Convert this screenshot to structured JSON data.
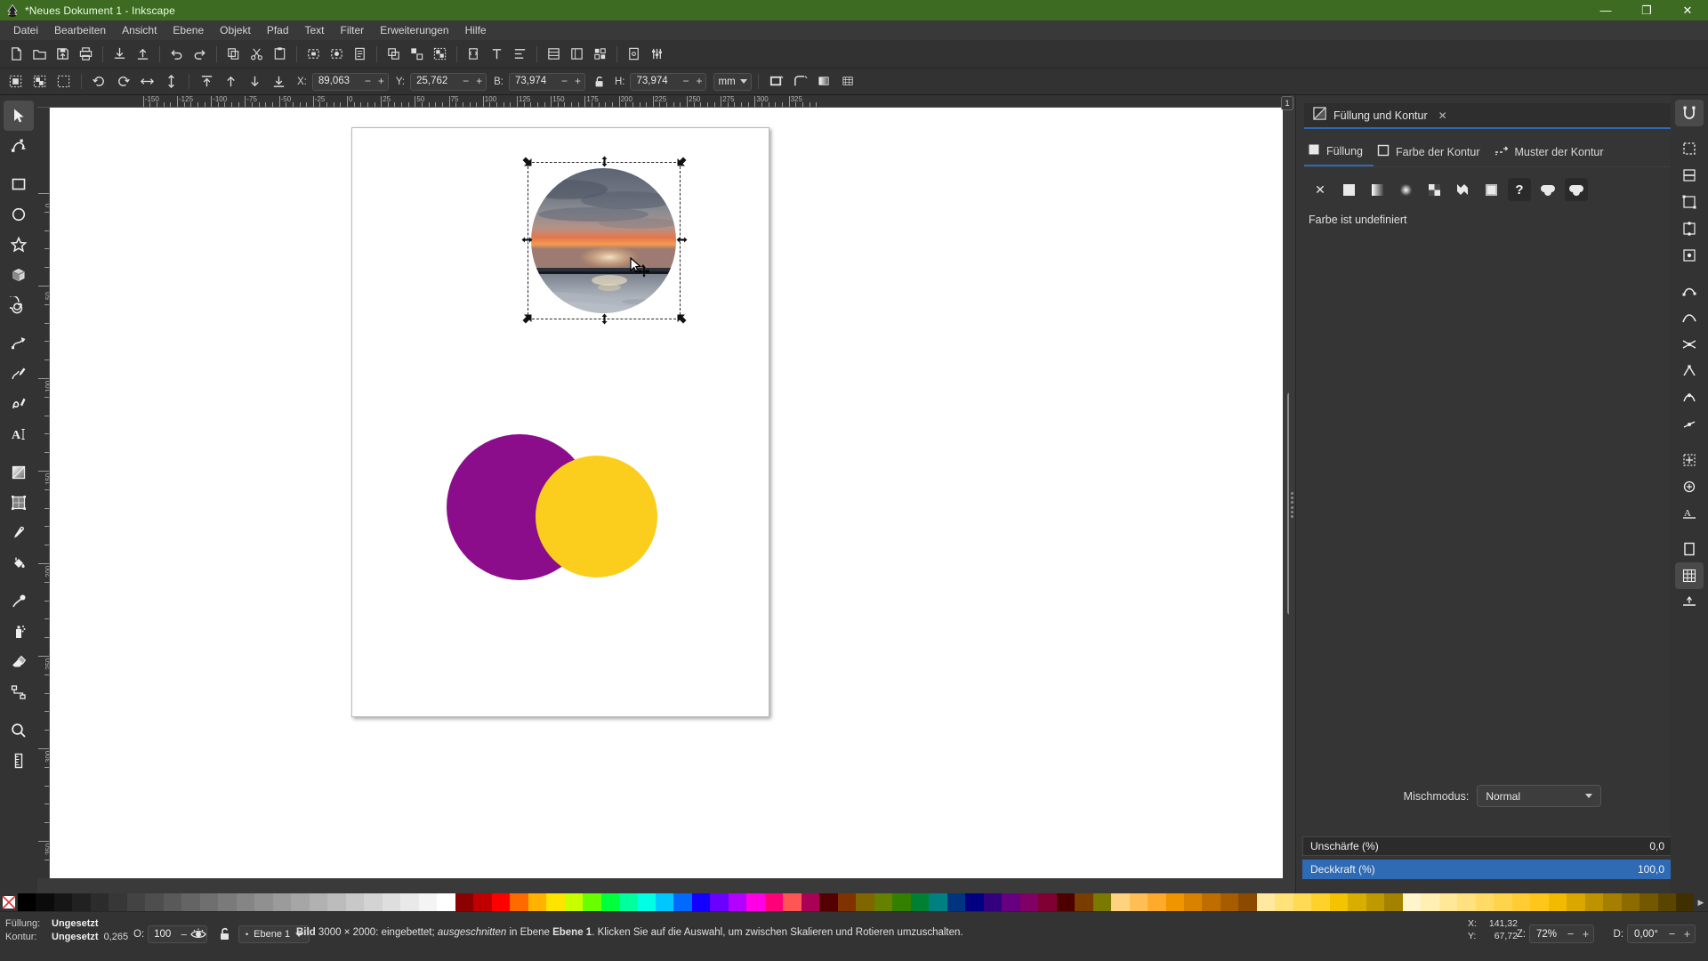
{
  "window": {
    "title": "*Neues Dokument 1 - Inkscape",
    "minimize": "—",
    "maximize": "❐",
    "close": "✕"
  },
  "menubar": {
    "items": [
      "Datei",
      "Bearbeiten",
      "Ansicht",
      "Ebene",
      "Objekt",
      "Pfad",
      "Text",
      "Filter",
      "Erweiterungen",
      "Hilfe"
    ]
  },
  "command_bar": {
    "buttons": [
      "new-document-icon",
      "open-document-icon",
      "save-document-icon",
      "print-icon",
      "import-icon",
      "export-icon",
      "undo-icon",
      "redo-icon",
      "copy-icon",
      "cut-icon",
      "paste-icon",
      "zoom-selection-icon",
      "zoom-drawing-icon",
      "zoom-page-icon",
      "duplicate-icon",
      "clone-icon",
      "group-icon",
      "ungroup-icon",
      "xml-editor-icon",
      "text-tool-icon",
      "align-icon",
      "objects-icon",
      "layers-icon",
      "tiled-clones-icon",
      "document-properties-icon",
      "preferences-icon"
    ]
  },
  "tool_options": {
    "select_all_icon": "select-all-icon",
    "select_all_layers_icon": "select-all-layers-icon",
    "deselect_icon": "deselect-icon",
    "rotate_ccw_icon": "rotate-ccw-icon",
    "rotate_cw_icon": "rotate-cw-icon",
    "flip_h_icon": "flip-horizontal-icon",
    "flip_v_icon": "flip-vertical-icon",
    "raise_to_top_icon": "raise-to-top-icon",
    "raise_icon": "raise-icon",
    "lower_icon": "lower-icon",
    "lower_to_bottom_icon": "lower-to-bottom-icon",
    "x_label": "X:",
    "x_value": "89,063",
    "y_label": "Y:",
    "y_value": "25,762",
    "w_label": "B:",
    "w_value": "73,974",
    "h_label": "H:",
    "h_value": "73,974",
    "lock_icon": "unlocked-ratio-icon",
    "unit": "mm",
    "minus": "−",
    "plus": "+",
    "affect_stroke_icon": "affect-stroke-width-icon",
    "affect_corners_icon": "affect-rounded-corners-icon",
    "affect_gradients_icon": "affect-gradients-icon",
    "affect_patterns_icon": "affect-patterns-icon"
  },
  "toolbox": {
    "tools": [
      {
        "name": "selector-tool",
        "icon": "arrow-cursor-icon",
        "active": true
      },
      {
        "name": "node-tool",
        "icon": "node-editor-icon",
        "active": false
      },
      {
        "name": "rectangle-tool",
        "icon": "rectangle-icon",
        "active": false
      },
      {
        "name": "ellipse-tool",
        "icon": "ellipse-icon",
        "active": false
      },
      {
        "name": "star-tool",
        "icon": "star-icon",
        "active": false
      },
      {
        "name": "box3d-tool",
        "icon": "cube-3d-icon",
        "active": false
      },
      {
        "name": "spiral-tool",
        "icon": "spiral-icon",
        "active": false
      },
      {
        "name": "bezier-tool",
        "icon": "bezier-pen-icon",
        "active": false
      },
      {
        "name": "pencil-tool",
        "icon": "pencil-icon",
        "active": false
      },
      {
        "name": "calligraphy-tool",
        "icon": "calligraphy-pen-icon",
        "active": false
      },
      {
        "name": "text-tool",
        "icon": "text-a-icon",
        "active": false
      },
      {
        "name": "gradient-tool",
        "icon": "gradient-icon",
        "active": false
      },
      {
        "name": "mesh-tool",
        "icon": "mesh-gradient-icon",
        "active": false
      },
      {
        "name": "dropper-tool",
        "icon": "color-picker-icon",
        "active": false
      },
      {
        "name": "paint-bucket-tool",
        "icon": "paint-bucket-icon",
        "active": false
      },
      {
        "name": "tweak-tool",
        "icon": "tweak-icon",
        "active": false
      },
      {
        "name": "spray-tool",
        "icon": "spray-can-icon",
        "active": false
      },
      {
        "name": "eraser-tool",
        "icon": "eraser-icon",
        "active": false
      },
      {
        "name": "connector-tool",
        "icon": "connector-icon",
        "active": false
      },
      {
        "name": "zoom-tool",
        "icon": "magnifier-icon",
        "active": false
      },
      {
        "name": "measure-tool",
        "icon": "measure-ruler-icon",
        "active": false
      }
    ]
  },
  "canvas": {
    "page_number": "1",
    "ruler_h_labels": [
      "-150",
      "-125",
      "-100",
      "-75",
      "-50",
      "-25",
      "0",
      "25",
      "50",
      "75",
      "100",
      "125",
      "150",
      "175",
      "200",
      "225",
      "250",
      "275",
      "300",
      "325"
    ],
    "ruler_v_labels": [
      "50",
      "0",
      "50",
      "100",
      "150",
      "200",
      "250",
      "300",
      "350"
    ],
    "selected_object": "clipped-sunset-image",
    "shapes": [
      {
        "name": "purple-circle",
        "color": "#8B0D8B"
      },
      {
        "name": "yellow-circle",
        "color": "#FBCE1E"
      }
    ]
  },
  "panel": {
    "tab_title": "Füllung und Kontur",
    "tab_icon": "fill-stroke-icon",
    "close_label": "✕",
    "subtabs": [
      {
        "label": "Füllung",
        "icon": "fill-swatch-icon",
        "active": true
      },
      {
        "label": "Farbe der Kontur",
        "icon": "stroke-paint-icon",
        "active": false
      },
      {
        "label": "Muster der Kontur",
        "icon": "stroke-style-icon",
        "active": false
      }
    ],
    "fill_types": [
      {
        "name": "no-paint-button",
        "glyph": "✕",
        "selected": false
      },
      {
        "name": "flat-color-button",
        "glyph": "",
        "selected": false
      },
      {
        "name": "linear-gradient-button",
        "glyph": "",
        "selected": false
      },
      {
        "name": "radial-gradient-button",
        "glyph": "",
        "selected": false
      },
      {
        "name": "pattern-button",
        "glyph": "",
        "selected": false
      },
      {
        "name": "swatch-button",
        "glyph": "",
        "selected": false
      },
      {
        "name": "mesh-gradient-button",
        "glyph": "",
        "selected": false
      },
      {
        "name": "unknown-paint-button",
        "glyph": "?",
        "selected": true
      },
      {
        "name": "flat-swatch-a-button",
        "glyph": "",
        "selected": false
      },
      {
        "name": "flat-swatch-b-button",
        "glyph": "",
        "selected": false
      }
    ],
    "undefined_message": "Farbe ist undefiniert",
    "blend_label": "Mischmodus:",
    "blend_value": "Normal",
    "blur_label": "Unschärfe (%)",
    "blur_value": "0,0",
    "opacity_label": "Deckkraft (%)",
    "opacity_value": "100,0",
    "minus": "−",
    "plus": "+"
  },
  "snapbar": {
    "buttons": [
      "enable-snapping-icon",
      "snap-bounding-box-icon",
      "snap-bbox-edges-icon",
      "snap-bbox-corners-icon",
      "snap-bbox-edge-midpoints-icon",
      "snap-bbox-centers-icon",
      "snap-nodes-icon",
      "snap-paths-icon",
      "snap-path-intersections-icon",
      "snap-cusp-nodes-icon",
      "snap-smooth-nodes-icon",
      "snap-line-midpoints-icon",
      "snap-object-centers-icon",
      "snap-rotation-centers-icon",
      "snap-text-baseline-icon",
      "snap-page-border-icon",
      "snap-grid-icon",
      "snap-guides-icon"
    ]
  },
  "statusbar": {
    "fill_label": "Füllung:",
    "fill_value": "Ungesetzt",
    "stroke_label": "Kontur:",
    "stroke_value": "Ungesetzt",
    "stroke_width": "0,265",
    "opacity_label": "O:",
    "opacity_value": "100",
    "minus": "−",
    "plus": "+",
    "eye_icon": "eye-visible-icon",
    "lock_icon": "layer-unlocked-icon",
    "layer_name": "Ebene 1",
    "message_parts": {
      "bold1": "Bild",
      "text1": " 3000 × 2000: eingebettet; ",
      "italic1": "ausgeschnitten",
      "text2": " in Ebene ",
      "bold2": "Ebene 1",
      "text3": ". Klicken Sie auf die Auswahl, um zwischen Skalieren und Rotieren umzuschalten."
    },
    "cursor_x_label": "X:",
    "cursor_x_value": "141,32",
    "cursor_y_label": "Y:",
    "cursor_y_value": "67,72",
    "zoom_label": "Z:",
    "zoom_value": "72%",
    "rotation_label": "D:",
    "rotation_value": "0,00°"
  },
  "colors": {
    "titlebar": "#3c6b21",
    "accent": "#2f6bb5",
    "purple": "#8B0D8B",
    "yellow": "#FBCE1E"
  }
}
